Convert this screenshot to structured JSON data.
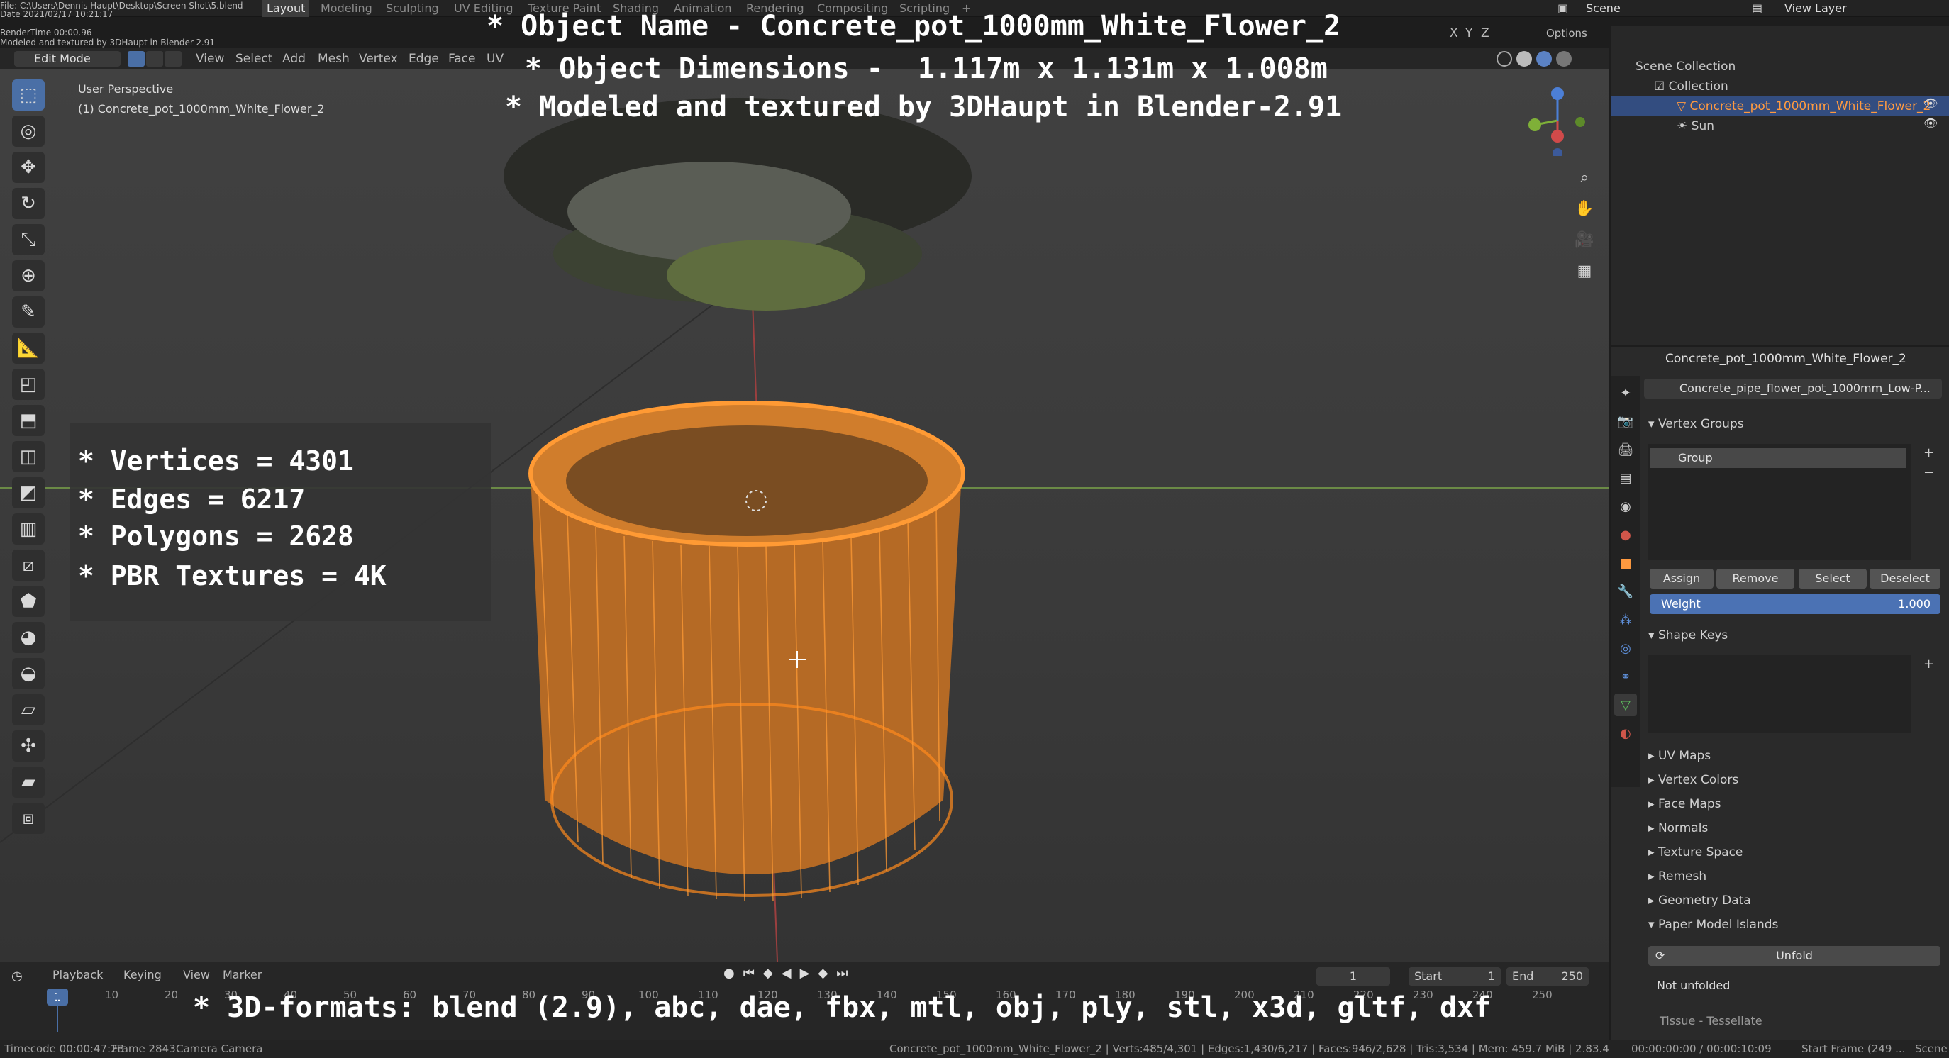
{
  "topbar": {
    "tabs": [
      "Layout",
      "Modeling",
      "Sculpting",
      "UV Editing",
      "Texture Paint",
      "Shading",
      "Animation",
      "Rendering",
      "Compositing",
      "Scripting"
    ],
    "active_tab": "Layout",
    "scene": "Scene",
    "view_layer": "View Layer",
    "file_info": "File: C:\\Users\\Dennis Haupt\\Desktop\\Screen Shot\\5.blend",
    "date_info": "Date 2021/02/17 10:21:17",
    "render_time": "RenderTime 00:00.96",
    "note": "Modeled and textured by 3DHaupt in Blender-2.91"
  },
  "viewport_header": {
    "mode": "Edit Mode",
    "menus": [
      "View",
      "Select",
      "Add",
      "Mesh",
      "Vertex",
      "Edge",
      "Face",
      "UV"
    ],
    "options": "Options",
    "axes": [
      "X",
      "Y",
      "Z"
    ]
  },
  "viewport": {
    "perspective": "User Perspective",
    "object_label": "(1) Concrete_pot_1000mm_White_Flower_2"
  },
  "overlay": {
    "name_line": "* Object Name - Concrete_pot_1000mm_White_Flower_2",
    "dims_line": "* Object Dimensions -  1.117m x 1.131m x 1.008m",
    "author_line": "* Modeled and textured by 3DHaupt in Blender-2.91",
    "formats_line": "* 3D-formats: blend (2.9), abc, dae, fbx, mtl, obj, ply, stl, x3d, gltf, dxf"
  },
  "stats": {
    "vertices": "* Vertices = 4301",
    "edges": "* Edges = 6217",
    "polygons": "* Polygons = 2628",
    "textures": "* PBR Textures = 4K"
  },
  "outliner": {
    "root": "Scene Collection",
    "collection": "Collection",
    "items": [
      "Concrete_pot_1000mm_White_Flower_2",
      "Sun"
    ]
  },
  "properties": {
    "object_name": "Concrete_pot_1000mm_White_Flower_2",
    "mesh_name": "Concrete_pipe_flower_pot_1000mm_Low-P...",
    "vertex_groups_title": "Vertex Groups",
    "group_item": "Group",
    "buttons": {
      "assign": "Assign",
      "remove": "Remove",
      "select": "Select",
      "deselect": "Deselect"
    },
    "weight_label": "Weight",
    "weight_value": "1.000",
    "shape_keys_title": "Shape Keys",
    "sections": [
      "UV Maps",
      "Vertex Colors",
      "Face Maps",
      "Normals",
      "Texture Space",
      "Remesh",
      "Geometry Data"
    ],
    "paper_model": "Paper Model Islands",
    "unfold": "Unfold",
    "not_unfolded": "Not unfolded",
    "tissue": "Tissue - Tessellate"
  },
  "timeline": {
    "menus": [
      "Playback",
      "Keying",
      "View",
      "Marker"
    ],
    "current_frame": "1",
    "start_label": "Start",
    "start": "1",
    "end_label": "End",
    "end": "250",
    "ticks": [
      "1",
      "10",
      "20",
      "30",
      "40",
      "50",
      "60",
      "70",
      "80",
      "90",
      "100",
      "110",
      "120",
      "130",
      "140",
      "150",
      "160",
      "170",
      "180",
      "190",
      "200",
      "210",
      "220",
      "230",
      "240",
      "250"
    ]
  },
  "statusbar": {
    "left": "Timecode 00:00:47:23",
    "frame": "Frame 2843",
    "camera": "Camera Camera",
    "stats": "Concrete_pot_1000mm_White_Flower_2 | Verts:485/4,301 | Edges:1,430/6,217 | Faces:946/2,628 | Tris:3,534 | Mem: 459.7 MiB | 2.83.4",
    "time": "00:00:00:00 / 00:00:10:09",
    "start_frame": "Start Frame (249 ...",
    "scene": "Scene"
  },
  "colors": {
    "selection": "#ff8a1c",
    "accent": "#4a6fa6",
    "weight_bar": "#4b72b4"
  }
}
